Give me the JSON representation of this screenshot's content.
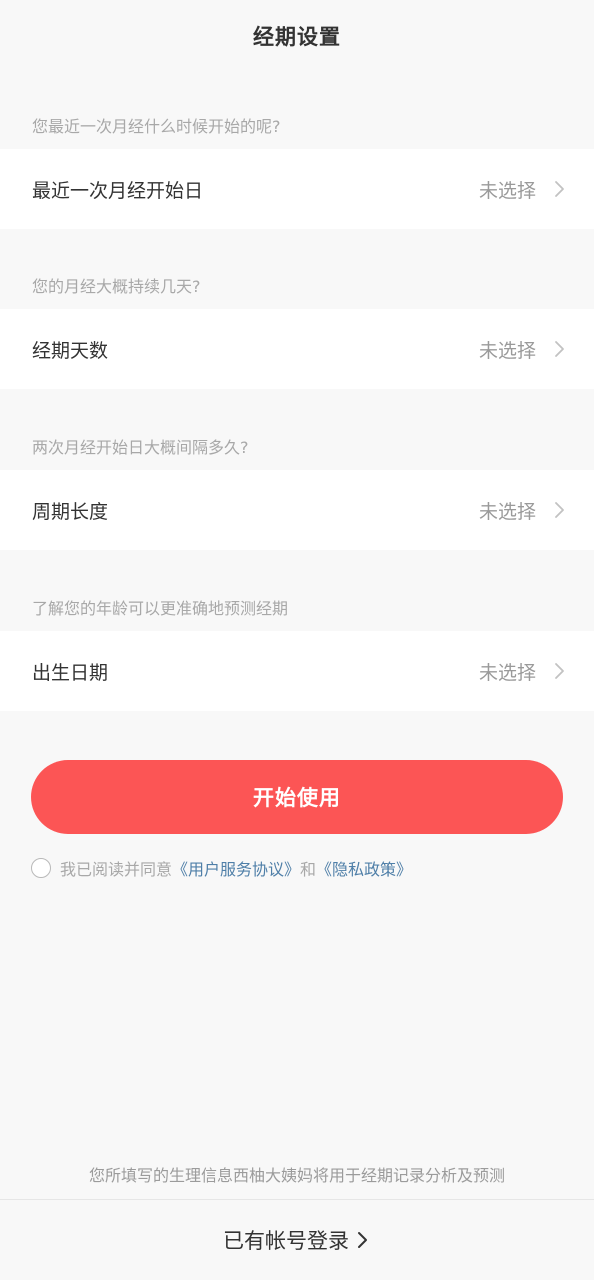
{
  "header": {
    "title": "经期设置"
  },
  "sections": [
    {
      "hint": "您最近一次月经什么时候开始的呢?",
      "label": "最近一次月经开始日",
      "value": "未选择"
    },
    {
      "hint": "您的月经大概持续几天?",
      "label": "经期天数",
      "value": "未选择"
    },
    {
      "hint": "两次月经开始日大概间隔多久?",
      "label": "周期长度",
      "value": "未选择"
    },
    {
      "hint": "了解您的年龄可以更准确地预测经期",
      "label": "出生日期",
      "value": "未选择"
    }
  ],
  "start_button": {
    "label": "开始使用"
  },
  "agreement": {
    "prefix": "我已阅读并同意",
    "user_agreement": "《用户服务协议》",
    "conjunction": "和",
    "privacy_policy": "《隐私政策》",
    "checked": false
  },
  "footer": {
    "note": "您所填写的生理信息西柚大姨妈将用于经期记录分析及预测",
    "login_label": "已有帐号登录"
  },
  "colors": {
    "accent": "#fc5555",
    "link": "#4f7fa8",
    "background": "#f8f8f8"
  }
}
